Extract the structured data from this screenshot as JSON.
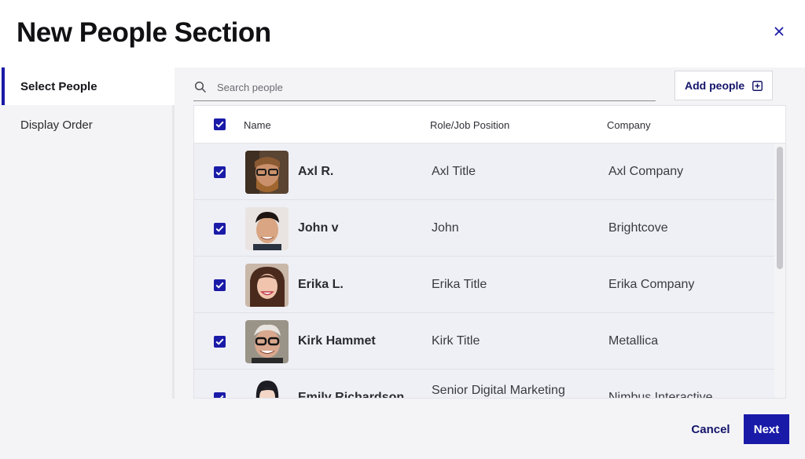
{
  "dialog": {
    "title": "New People Section",
    "close_icon": "close-icon"
  },
  "sidebar": {
    "items": [
      {
        "label": "Select People",
        "active": true
      },
      {
        "label": "Display Order",
        "active": false
      }
    ]
  },
  "search": {
    "placeholder": "Search people",
    "value": "",
    "icon": "search-icon"
  },
  "add_button": {
    "label": "Add people",
    "icon": "add-box-icon"
  },
  "table": {
    "columns": [
      "Name",
      "Role/Job Position",
      "Company"
    ],
    "select_all_checked": true,
    "rows": [
      {
        "name": "Axl R.",
        "role": "Axl Title",
        "company": "Axl Company",
        "checked": true
      },
      {
        "name": "John v",
        "role": "John",
        "company": "Brightcove",
        "checked": true
      },
      {
        "name": "Erika L.",
        "role": "Erika Title",
        "company": "Erika Company",
        "checked": true
      },
      {
        "name": "Kirk Hammet",
        "role": "Kirk Title",
        "company": "Metallica",
        "checked": true
      },
      {
        "name": "Emily Richardson",
        "role": "Senior Digital Marketing",
        "company": "Nimbus Interactive",
        "checked": true
      }
    ]
  },
  "footer": {
    "cancel_label": "Cancel",
    "next_label": "Next"
  },
  "colors": {
    "accent": "#1a1aa8",
    "link_text": "#14146b",
    "row_bg": "#eff0f5",
    "panel_bg": "#f4f4f6"
  }
}
